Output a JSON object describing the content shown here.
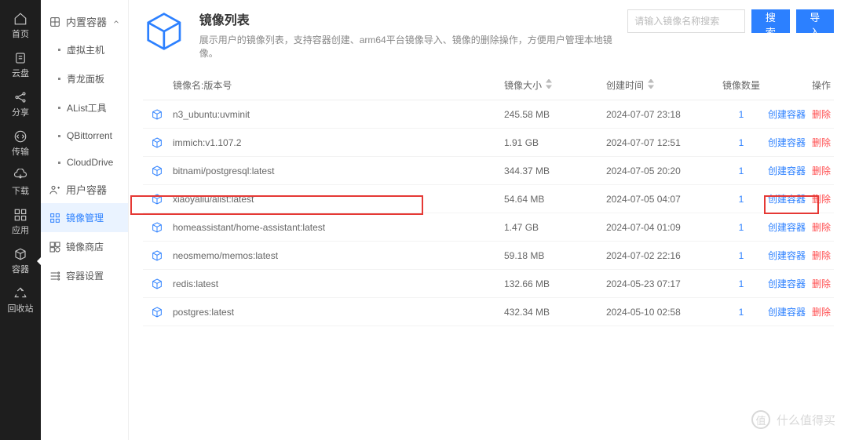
{
  "dark_nav": [
    {
      "id": "home",
      "label": "首页"
    },
    {
      "id": "cloud",
      "label": "云盘"
    },
    {
      "id": "share",
      "label": "分享"
    },
    {
      "id": "transfer",
      "label": "传输"
    },
    {
      "id": "download",
      "label": "下载"
    },
    {
      "id": "apps",
      "label": "应用"
    },
    {
      "id": "container",
      "label": "容器",
      "active": true
    },
    {
      "id": "recycle",
      "label": "回收站"
    }
  ],
  "sidebar": {
    "section_builtin": "内置容器",
    "items": [
      "虚拟主机",
      "青龙面板",
      "AList工具",
      "QBittorrent",
      "CloudDrive"
    ],
    "section_user": "用户容器",
    "icon_items": [
      {
        "id": "image-manage",
        "label": "镜像管理",
        "active": true
      },
      {
        "id": "image-store",
        "label": "镜像商店"
      },
      {
        "id": "container-settings",
        "label": "容器设置"
      }
    ]
  },
  "header": {
    "title": "镜像列表",
    "subtitle": "展示用户的镜像列表，支持容器创建、arm64平台镜像导入、镜像的删除操作，方便用户管理本地镜像。"
  },
  "search": {
    "placeholder": "请输入镜像名称搜索",
    "search_btn": "搜索",
    "import_btn": "导入"
  },
  "table": {
    "headers": {
      "name": "镜像名:版本号",
      "size": "镜像大小",
      "time": "创建时间",
      "count": "镜像数量",
      "op": "操作"
    },
    "op_create": "创建容器",
    "op_delete": "删除",
    "rows": [
      {
        "name": "n3_ubuntu:uvminit",
        "size": "245.58 MB",
        "time": "2024-07-07 23:18",
        "count": "1"
      },
      {
        "name": "immich:v1.107.2",
        "size": "1.91 GB",
        "time": "2024-07-07 12:51",
        "count": "1"
      },
      {
        "name": "bitnami/postgresql:latest",
        "size": "344.37 MB",
        "time": "2024-07-05 20:20",
        "count": "1"
      },
      {
        "name": "xiaoyaliu/alist:latest",
        "size": "54.64 MB",
        "time": "2024-07-05 04:07",
        "count": "1"
      },
      {
        "name": "homeassistant/home-assistant:latest",
        "size": "1.47 GB",
        "time": "2024-07-04 01:09",
        "count": "1",
        "highlight": true
      },
      {
        "name": "neosmemo/memos:latest",
        "size": "59.18 MB",
        "time": "2024-07-02 22:16",
        "count": "1"
      },
      {
        "name": "redis:latest",
        "size": "132.66 MB",
        "time": "2024-05-23 07:17",
        "count": "1"
      },
      {
        "name": "postgres:latest",
        "size": "432.34 MB",
        "time": "2024-05-10 02:58",
        "count": "1"
      }
    ]
  },
  "watermark": {
    "mark": "值",
    "text": "什么值得买"
  }
}
